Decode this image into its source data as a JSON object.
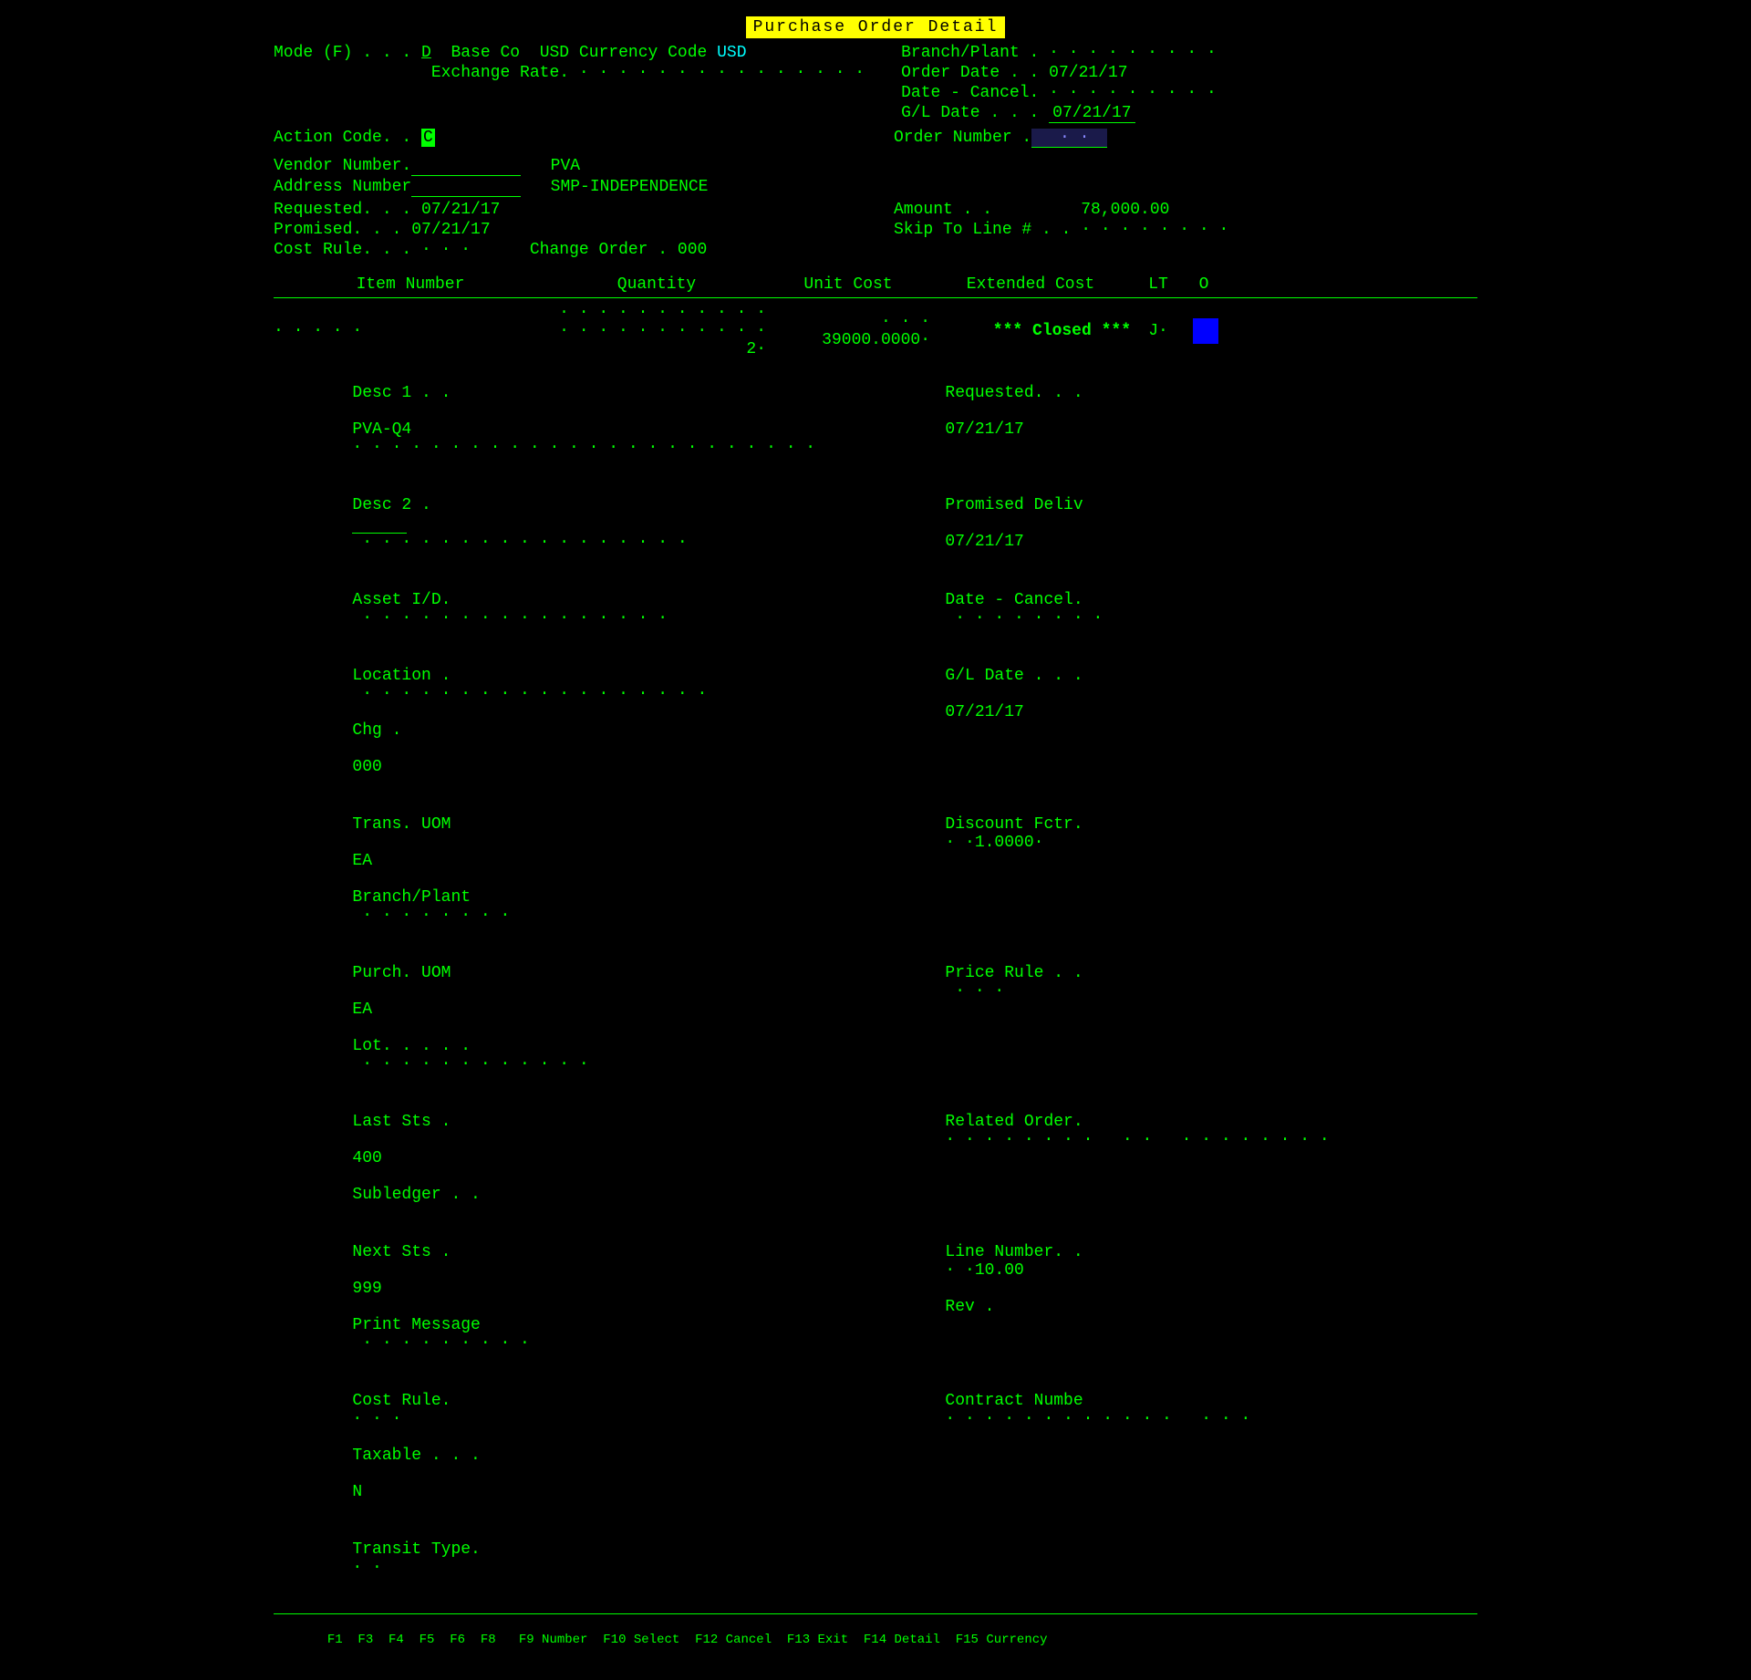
{
  "title": "Purchase Order Detail",
  "header": {
    "mode_label": "Mode (F) . . . D",
    "mode_value": "D",
    "base_co_label": "Base Co",
    "base_co_value": "Base Co",
    "currency_label": "USD Currency Code",
    "currency_value": "USD",
    "exchange_rate_label": "Exchange Rate.",
    "exchange_rate_dots": "· · · · · · · · · · · · · · ·",
    "branch_plant_label": "Branch/Plant .",
    "branch_plant_dots": "· · · · · · · · ·",
    "order_date_label": "Order Date . .",
    "order_date_value": "07/21/17",
    "date_cancel_label": "Date - Cancel.",
    "date_cancel_dots": "· · · · · · · · ·",
    "gl_date_label": "G/L Date . . .",
    "gl_date_value": "07/21/17",
    "action_code_label": "Action Code. .",
    "action_code_value": "C",
    "order_number_label": "Order Number .",
    "order_number_dots": "· ·"
  },
  "vendor": {
    "vendor_number_label": "Vendor Number.",
    "vendor_number_dots": "________",
    "vendor_name": "PVA",
    "address_number_label": "Address Number",
    "address_number_dots": "________",
    "address_name": "SMP-INDEPENDENCE",
    "requested_label": "Requested. . .",
    "requested_value": "07/21/17",
    "promised_label": "Promised. . .",
    "promised_value": "07/21/17",
    "amount_label": "Amount . .",
    "amount_value": "78,000.00",
    "cost_rule_label": "Cost Rule. . .",
    "cost_rule_dots": "· · ·",
    "change_order_label": "Change Order .",
    "change_order_value": "000",
    "skip_to_line_label": "Skip To Line # . .",
    "skip_to_line_dots": "· · · · · · · ·"
  },
  "table": {
    "col_item": "Item Number",
    "col_qty": "Quantity",
    "col_unit": "Unit Cost",
    "col_ext": "Extended Cost",
    "col_lt": "LT",
    "col_o": "O",
    "row1": {
      "item": "· · · · ·",
      "qty": "· · · · · · · · · · · · · · · · · · · · · · 2·",
      "unit_cost": "· · · 39000.0000·",
      "ext_cost": "*** Closed ***",
      "lt": "J·",
      "o": ""
    }
  },
  "detail": {
    "desc1_label": "Desc 1 . .",
    "desc1_value": "PVA-Q4",
    "desc1_dots": "· · · · · · · · · · · · · · · · · · · · · · · ·",
    "requested_label": "Requested. . .",
    "requested_value": "07/21/17",
    "desc2_label": "Desc 2 .",
    "desc2_dots_left": "________",
    "desc2_dots_right": "· · · · · · · · · · · · · · · · ·",
    "promised_deliv_label": "Promised Deliv",
    "promised_deliv_value": "07/21/17",
    "asset_id_label": "Asset I/D.",
    "asset_id_dots": "· · · · · · · · · · · · · · · ·",
    "date_cancel_label": "Date - Cancel.",
    "date_cancel_dots": "· · · · · · · ·",
    "location_label": "Location .",
    "location_dots": "· · · · · · · · · · · · · · · · · ·",
    "chg_label": "Chg .",
    "chg_value": "000",
    "gl_date_label": "G/L Date . . .",
    "gl_date_value": "07/21/17",
    "trans_uom_label": "Trans. UOM",
    "trans_uom_value": "EA",
    "branch_plant_label": "Branch/Plant",
    "branch_plant_dots": "· · · · · · · ·",
    "discount_fctr_label": "Discount Fctr.",
    "discount_fctr_value": "· ·1.0000·",
    "purch_uom_label": "Purch. UOM",
    "purch_uom_value": "EA",
    "lot_label": "Lot. . . . .",
    "lot_dots": "· · · · · · · · · · · ·",
    "price_rule_label": "Price Rule . .",
    "price_rule_dots": "· · ·",
    "last_sts_label": "Last Sts .",
    "last_sts_value": "400",
    "subledger_label": "Subledger . .",
    "related_order_label": "Related Order.",
    "related_order_dots": "· · · · · · · ·   · ·   · · · · · · · ·",
    "next_sts_label": "Next Sts .",
    "next_sts_value": "999",
    "print_msg_label": "Print Message",
    "print_msg_dots": "· · · · · · · · ·",
    "line_number_label": "Line Number. .",
    "line_number_value": "· ·10.00",
    "rev_label": "Rev .",
    "cost_rule_label": "Cost Rule.",
    "cost_rule_dots": "· · ·",
    "taxable_label": "Taxable . . .",
    "taxable_value": "N",
    "contract_numbe_label": "Contract Numbe",
    "contract_numbe_dots": "· · · · · · · · · · · ·   · · ·",
    "transit_type_label": "Transit Type.",
    "transit_type_dots": "· ·"
  },
  "bottom_bar": "   F1  F3  F4  F5  F6  F8   F9 Number  F10 Select  F12 Cancel  F13 Exit  F14 Detail  F15 Currency"
}
